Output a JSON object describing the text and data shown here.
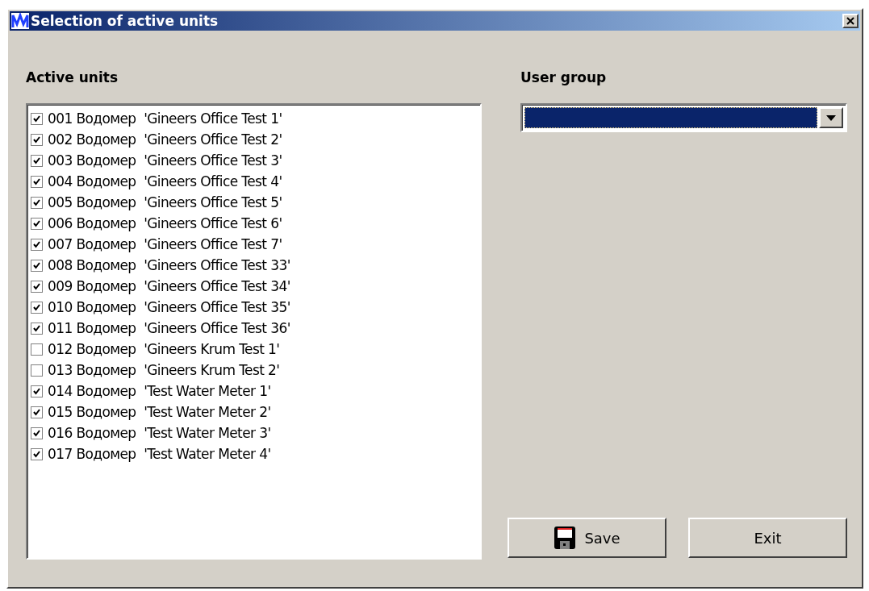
{
  "window": {
    "title": "Selection of active units"
  },
  "active_units": {
    "label": "Active units",
    "items": [
      {
        "text": "001 Водомер  'Gineers Office Test 1'",
        "checked": true
      },
      {
        "text": "002 Водомер  'Gineers Office Test 2'",
        "checked": true
      },
      {
        "text": "003 Водомер  'Gineers Office Test 3'",
        "checked": true
      },
      {
        "text": "004 Водомер  'Gineers Office Test 4'",
        "checked": true
      },
      {
        "text": "005 Водомер  'Gineers Office Test 5'",
        "checked": true
      },
      {
        "text": "006 Водомер  'Gineers Office Test 6'",
        "checked": true
      },
      {
        "text": "007 Водомер  'Gineers Office Test 7'",
        "checked": true
      },
      {
        "text": "008 Водомер  'Gineers Office Test 33'",
        "checked": true
      },
      {
        "text": "009 Водомер  'Gineers Office Test 34'",
        "checked": true
      },
      {
        "text": "010 Водомер  'Gineers Office Test 35'",
        "checked": true
      },
      {
        "text": "011 Водомер  'Gineers Office Test 36'",
        "checked": true
      },
      {
        "text": "012 Водомер  'Gineers Krum Test 1'",
        "checked": false
      },
      {
        "text": "013 Водомер  'Gineers Krum Test 2'",
        "checked": false
      },
      {
        "text": "014 Водомер  'Test Water Meter 1'",
        "checked": true
      },
      {
        "text": "015 Водомер  'Test Water Meter 2'",
        "checked": true
      },
      {
        "text": "016 Водомер  'Test Water Meter 3'",
        "checked": true
      },
      {
        "text": "017 Водомер  'Test Water Meter 4'",
        "checked": true
      }
    ]
  },
  "user_group": {
    "label": "User group"
  },
  "buttons": [
    {
      "label": "Save",
      "kind": "save"
    },
    {
      "label": "Exit",
      "kind": "plain"
    }
  ]
}
